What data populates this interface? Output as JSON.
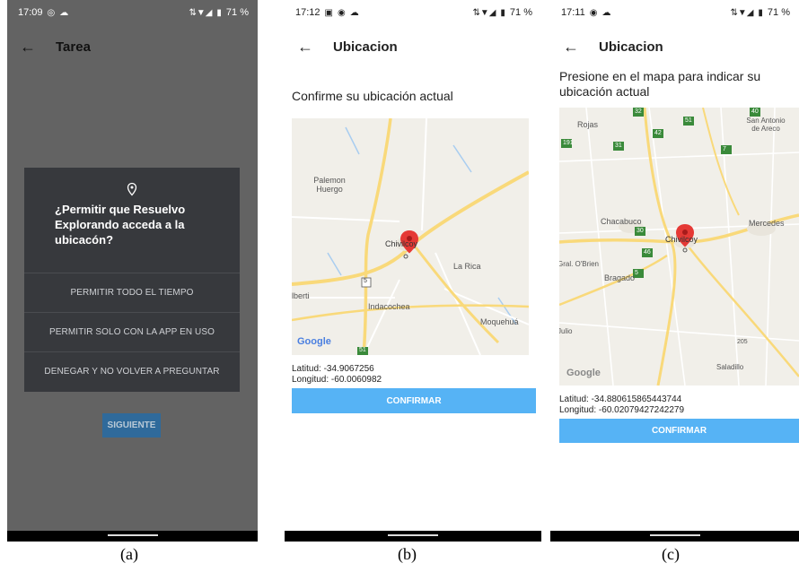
{
  "panel_a": {
    "status_time": "17:09",
    "status_battery": "71 %",
    "title": "Tarea",
    "dialog": {
      "title": "¿Permitir que Resuelvo Explorando acceda a la ubicacón?",
      "options": [
        "PERMITIR TODO EL TIEMPO",
        "PERMITIR SOLO CON LA APP EN USO",
        "DENEGAR Y NO VOLVER A PREGUNTAR"
      ]
    },
    "next_button": "SIGUIENTE",
    "caption": "(a)"
  },
  "panel_b": {
    "status_time": "17:12",
    "status_battery": "71 %",
    "title": "Ubicacion",
    "prompt": "Confirme su ubicación actual",
    "map": {
      "labels": [
        "Palemon Huergo",
        "Chivilcoy",
        "La Rica",
        "Alberti",
        "Indacochea",
        "Moquehuá",
        "Google",
        "5",
        "51"
      ]
    },
    "latitude": "Latitud: -34.9067256",
    "longitude": "Longitud: -60.0060982",
    "confirm_button": "CONFIRMAR",
    "caption": "(b)"
  },
  "panel_c": {
    "status_time": "17:11",
    "status_battery": "71 %",
    "title": "Ubicacion",
    "prompt": "Presione en el mapa para indicar su ubicación actual",
    "map": {
      "labels": [
        "Rojas",
        "San Antonio de Areco",
        "Chacabuco",
        "Mercedes",
        "Chivilcoy",
        "Gral. O'Brien",
        "Bragado",
        "Julio",
        "Saladillo",
        "Google",
        "32",
        "191",
        "31",
        "51",
        "42",
        "7",
        "30",
        "5",
        "46",
        "40",
        "205"
      ]
    },
    "latitude": "Latitud: -34.880615865443744",
    "longitude": "Longitud: -60.02079427242279",
    "confirm_button": "CONFIRMAR",
    "caption": "(c)"
  },
  "colors": {
    "confirm_button": "#56b3f5",
    "dim_overlay": "#636363",
    "dialog": "#37393d",
    "pin": "#e53935",
    "highway": "#f9d97a"
  }
}
